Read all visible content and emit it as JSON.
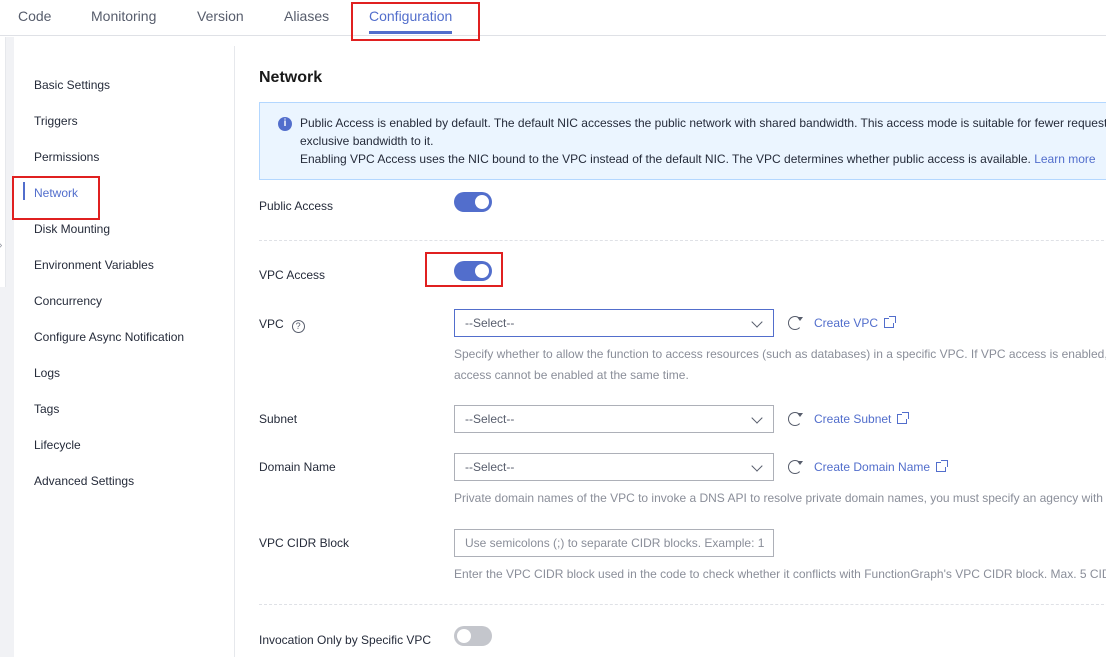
{
  "tabs": [
    {
      "label": "Code"
    },
    {
      "label": "Monitoring"
    },
    {
      "label": "Version"
    },
    {
      "label": "Aliases"
    },
    {
      "label": "Configuration"
    }
  ],
  "sidebar": {
    "items": [
      {
        "label": "Basic Settings"
      },
      {
        "label": "Triggers"
      },
      {
        "label": "Permissions"
      },
      {
        "label": "Network"
      },
      {
        "label": "Disk Mounting"
      },
      {
        "label": "Environment Variables"
      },
      {
        "label": "Concurrency"
      },
      {
        "label": "Configure Async Notification"
      },
      {
        "label": "Logs"
      },
      {
        "label": "Tags"
      },
      {
        "label": "Lifecycle"
      },
      {
        "label": "Advanced Settings"
      }
    ],
    "active": "Network"
  },
  "network": {
    "title": "Network",
    "notice": {
      "line1": "Public Access is enabled by default. The default NIC accesses the public network with shared bandwidth. This access mode is suitable for fewer request",
      "line2": "exclusive bandwidth to it.",
      "line3": "Enabling VPC Access uses the NIC bound to the VPC instead of the default NIC. The VPC determines whether public access is available.",
      "learn_more": "Learn more"
    },
    "public_access": {
      "label": "Public Access",
      "enabled": true
    },
    "vpc_access": {
      "label": "VPC Access",
      "enabled": true
    },
    "vpc": {
      "label": "VPC",
      "help_icon": "?",
      "placeholder": "--Select--",
      "create_label": "Create VPC",
      "hint_line1": "Specify whether to allow the function to access resources (such as databases) in a specific VPC. If VPC access is enabled,",
      "hint_line2": "access cannot be enabled at the same time."
    },
    "subnet": {
      "label": "Subnet",
      "placeholder": "--Select--",
      "create_label": "Create Subnet"
    },
    "domain_name": {
      "label": "Domain Name",
      "placeholder": "--Select--",
      "create_label": "Create Domain Name",
      "hint": "Private domain names of the VPC to invoke a DNS API to resolve private domain names, you must specify an agency with"
    },
    "cidr": {
      "label": "VPC CIDR Block",
      "placeholder": "Use semicolons (;) to separate CIDR blocks. Example: 1",
      "hint": "Enter the VPC CIDR block used in the code to check whether it conflicts with FunctionGraph's VPC CIDR block. Max. 5 CID"
    },
    "specific_vpc": {
      "label": "Invocation Only by Specific VPC",
      "enabled": false
    }
  },
  "colors": {
    "accent": "#526ecc",
    "annotation": "#e02020",
    "notice_bg": "#ebf5ff"
  }
}
